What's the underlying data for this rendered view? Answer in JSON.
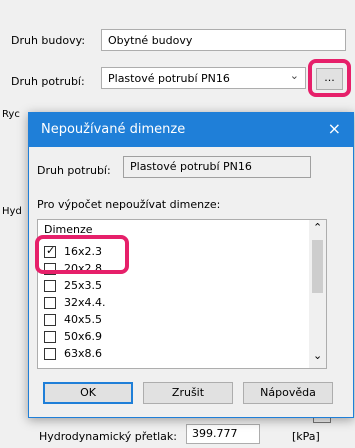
{
  "main": {
    "building_type_label": "Druh budovy:",
    "building_type_value": "Obytné budovy",
    "pipe_type_label": "Druh potrubí:",
    "pipe_type_value": "Plastové potrubí PN16",
    "browse_button": "...",
    "label_ryc": "Ryc",
    "label_hyd": "Hyd",
    "hydro_label": "Hydrodynamický přetlak:",
    "hydro_value": "399.777",
    "hydro_unit": "[kPa]"
  },
  "dialog": {
    "title": "Nepoužívané dimenze",
    "close_icon": "×",
    "pipe_label": "Druh potrubí:",
    "pipe_value": "Plastové potrubí PN16",
    "instruction": "Pro výpočet nepoužívat dimenze:",
    "list_header": "Dimenze",
    "items": [
      {
        "label": "16x2.3",
        "checked": true
      },
      {
        "label": "20x2.8",
        "checked": false
      },
      {
        "label": "25x3.5",
        "checked": false
      },
      {
        "label": "32x4.4.",
        "checked": false
      },
      {
        "label": "40x5.5",
        "checked": false
      },
      {
        "label": "50x6.9",
        "checked": false
      },
      {
        "label": "63x8.6",
        "checked": false
      }
    ],
    "ok": "OK",
    "cancel": "Zrušit",
    "help": "Nápověda"
  },
  "colors": {
    "highlight": "#e6206a",
    "titlebar": "#1f7fd8"
  }
}
